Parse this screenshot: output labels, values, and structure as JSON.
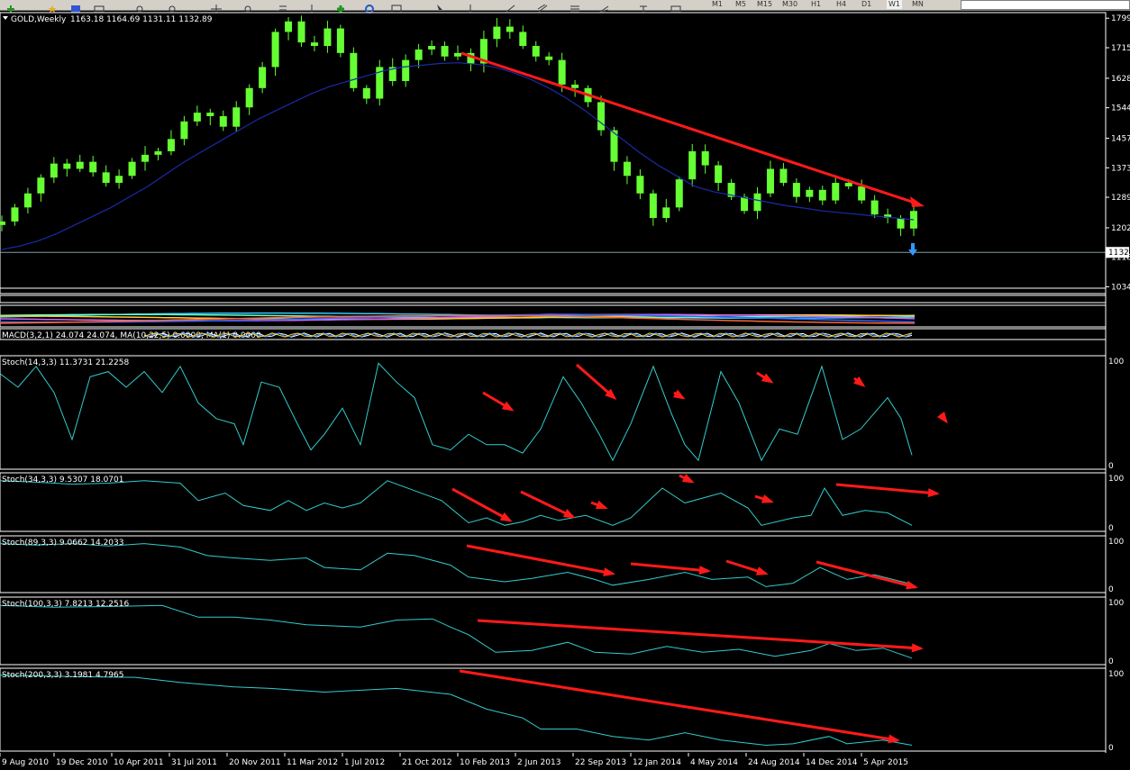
{
  "toolbar": {
    "timeframes": [
      "M1",
      "M5",
      "M15",
      "M30",
      "H1",
      "H4",
      "D1",
      "W1",
      "MN"
    ],
    "active_timeframe": "W1"
  },
  "chart_data": [
    {
      "type": "candlestick",
      "title": "GOLD,Weekly",
      "ohlc_label": "1163.18 1164.69 1131.11 1132.89",
      "yticks": [
        1799,
        1715,
        1628,
        1544,
        1457,
        1373,
        1289,
        1202,
        1118,
        1034
      ],
      "ylim": [
        1030,
        1815
      ],
      "current_price": "1132",
      "x": [
        0,
        4,
        8,
        12,
        16,
        20,
        24,
        28,
        32,
        36,
        40,
        44,
        48,
        52,
        56,
        60,
        64,
        68,
        72,
        76,
        80,
        84,
        88,
        92,
        96,
        100,
        104,
        108,
        112,
        116,
        120,
        124,
        128,
        132,
        136,
        140,
        144,
        148,
        152,
        156,
        160,
        164,
        168,
        172,
        176,
        180,
        184,
        188,
        192,
        196,
        200,
        204,
        208,
        212,
        216,
        220,
        224,
        228,
        232,
        236,
        240,
        244,
        248,
        252,
        256,
        260,
        264,
        268,
        272,
        276,
        280
      ],
      "close": [
        1220,
        1260,
        1300,
        1345,
        1385,
        1370,
        1390,
        1360,
        1330,
        1350,
        1390,
        1410,
        1420,
        1455,
        1505,
        1530,
        1520,
        1490,
        1545,
        1600,
        1660,
        1760,
        1790,
        1730,
        1720,
        1770,
        1700,
        1600,
        1570,
        1660,
        1620,
        1680,
        1710,
        1720,
        1690,
        1700,
        1670,
        1740,
        1775,
        1760,
        1720,
        1690,
        1680,
        1610,
        1600,
        1560,
        1480,
        1390,
        1350,
        1300,
        1230,
        1260,
        1340,
        1420,
        1380,
        1330,
        1290,
        1250,
        1300,
        1370,
        1330,
        1290,
        1310,
        1280,
        1330,
        1320,
        1280,
        1240,
        1230,
        1200,
        1250
      ],
      "ma": [
        1140,
        1150,
        1165,
        1185,
        1210,
        1235,
        1260,
        1290,
        1320,
        1355,
        1390,
        1420,
        1450,
        1480,
        1510,
        1535,
        1560,
        1585,
        1605,
        1620,
        1635,
        1650,
        1660,
        1665,
        1670,
        1672,
        1668,
        1660,
        1645,
        1625,
        1600,
        1570,
        1535,
        1495,
        1455,
        1415,
        1380,
        1350,
        1320,
        1305,
        1295,
        1285,
        1275,
        1265,
        1258,
        1250,
        1245,
        1240,
        1235,
        1230,
        1225
      ],
      "arrow": {
        "from": [
          1996,
          1695
        ],
        "to": [
          2014,
          1235
        ]
      }
    },
    {
      "type": "line",
      "title": "MACD(3,2,1) 24.074 24.074, MA(10,22,5) 0.0000, MA(1) 0.0000"
    },
    {
      "type": "line",
      "title": "Stoch(14,3,3) 11.3731 21.2258",
      "yticks": [
        100,
        0
      ],
      "ylim": [
        0,
        100
      ]
    },
    {
      "type": "line",
      "title": "Stoch(34,3,3) 9.5307 18.0701",
      "yticks": [
        100,
        0
      ],
      "ylim": [
        0,
        100
      ]
    },
    {
      "type": "line",
      "title": "Stoch(89,3,3) 9.0662 14.2033",
      "yticks": [
        100,
        0
      ],
      "ylim": [
        0,
        100
      ]
    },
    {
      "type": "line",
      "title": "Stoch(100,3,3) 7.8213 12.2516",
      "yticks": [
        100,
        0
      ],
      "ylim": [
        0,
        100
      ]
    },
    {
      "type": "line",
      "title": "Stoch(200,3,3) 3.1981 4.7965",
      "yticks": [
        100,
        0
      ],
      "ylim": [
        0,
        100
      ]
    }
  ],
  "xaxis_labels": [
    "9 Aug 2010",
    "19 Dec 2010",
    "10 Apr 2011",
    "31 Jul 2011",
    "20 Nov 2011",
    "11 Mar 2012",
    "1 Jul 2012",
    "21 Oct 2012",
    "10 Feb 2013",
    "2 Jun 2013",
    "22 Sep 2013",
    "12 Jan 2014",
    "4 May 2014",
    "24 Aug 2014",
    "14 Dec 2014",
    "5 Apr 2015"
  ],
  "colors": {
    "candle": "#66ff33",
    "ma": "#1a2aa8",
    "stoch": "#33cccc",
    "arrow": "#ff1a1a",
    "text": "#ffffff",
    "grid": "#ffffff"
  }
}
